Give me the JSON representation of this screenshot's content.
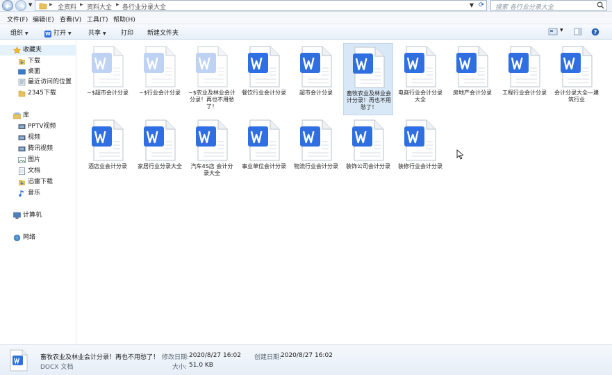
{
  "address": {
    "crumbs": [
      "全资料",
      "资料大全",
      "各行业分录大全"
    ],
    "search_placeholder": "搜索 各行业分录大全"
  },
  "menu": [
    "文件(F)",
    "编辑(E)",
    "查看(V)",
    "工具(T)",
    "帮助(H)"
  ],
  "toolbar": {
    "organize": "组织",
    "open": "打开",
    "share": "共享",
    "print": "打印",
    "new_folder": "新建文件夹",
    "wps_badge": "W"
  },
  "sidebar": {
    "favorites_header": "收藏夹",
    "favorites": [
      "下载",
      "桌面",
      "最近访问的位置",
      "2345下载"
    ],
    "library_header": "库",
    "library": [
      "PPTV视频",
      "视频",
      "腾讯视频",
      "图片",
      "文档",
      "迅雷下载",
      "音乐"
    ],
    "computer": "计算机",
    "network": "网络"
  },
  "files": [
    {
      "name": "~$超市会计分录",
      "faded": true
    },
    {
      "name": "~$行业会计分录",
      "faded": true
    },
    {
      "name": "~$农业及林业会计分录！再也不用愁了！",
      "faded": true
    },
    {
      "name": "餐饮行业会计分录",
      "faded": false
    },
    {
      "name": "超市会计分录",
      "faded": false
    },
    {
      "name": "畜牧农业及林业会计分录！再也不用愁了！",
      "faded": false,
      "selected": true
    },
    {
      "name": "电商行业会计分录大全",
      "faded": false
    },
    {
      "name": "房地产会计分录",
      "faded": false
    },
    {
      "name": "工程行业会计分录",
      "faded": false
    },
    {
      "name": "会计分录大全—建筑行业",
      "faded": false
    },
    {
      "name": "酒店业会计分录",
      "faded": false
    },
    {
      "name": "家居行业分录大全",
      "faded": false
    },
    {
      "name": "汽车4S店 会计分录大全",
      "faded": false
    },
    {
      "name": "事业单位会计分录",
      "faded": false
    },
    {
      "name": "物流行业会计分录",
      "faded": false
    },
    {
      "name": "装饰公司会计分录",
      "faded": false
    },
    {
      "name": "装修行业会计分录",
      "faded": false
    }
  ],
  "details": {
    "filename": "畜牧农业及林业会计分录！再也不用愁了！",
    "modified_label": "修改日期:",
    "modified_value": "2020/8/27 16:02",
    "created_label": "创建日期:",
    "created_value": "2020/8/27 16:02",
    "type": "DOCX 文档",
    "size_label": "大小:",
    "size_value": "51.0 KB"
  },
  "colors": {
    "wps_blue": "#2f6fe1",
    "wps_blue_faded": "#a9c3ef",
    "selection": "#d9e8f7"
  }
}
